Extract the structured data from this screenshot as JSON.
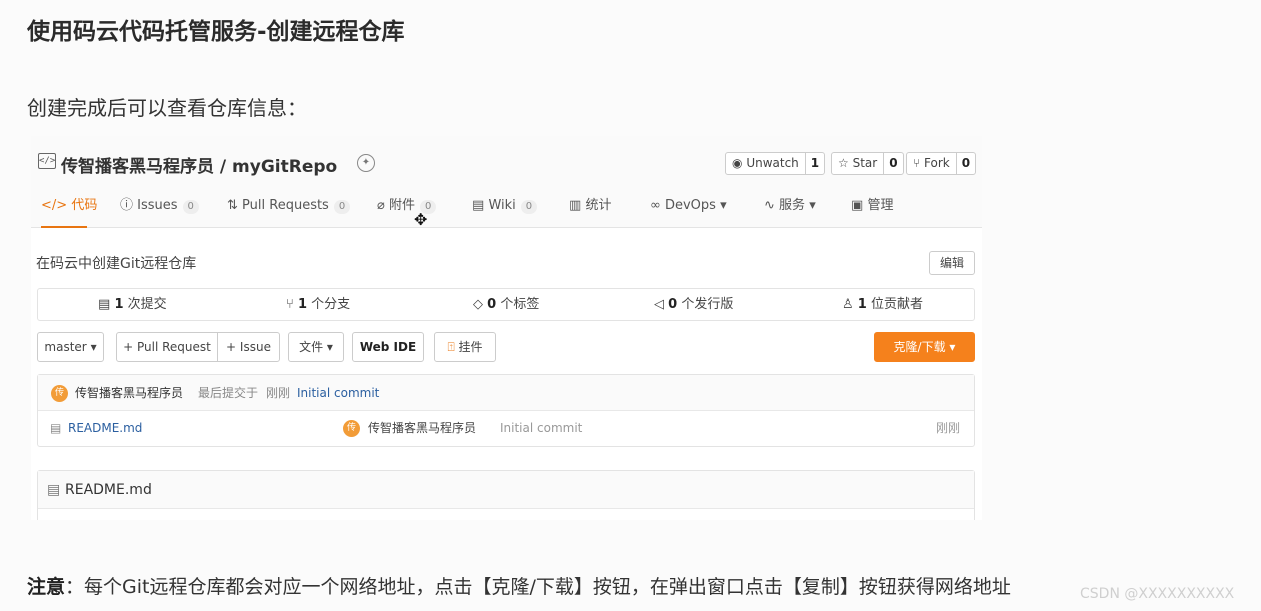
{
  "doc": {
    "heading": "使用码云代码托管服务-创建远程仓库",
    "intro": "创建完成后可以查看仓库信息：",
    "note_bold": "注意",
    "note_text": "：每个Git远程仓库都会对应一个网络地址，点击【克隆/下载】按钮，在弹出窗口点击【复制】按钮获得网络地址",
    "watermark": "CSDN @XXXXXXXXXX"
  },
  "repo": {
    "title": "传智播客黑马程序员 / myGitRepo",
    "description": "在码云中创建Git远程仓库",
    "edit_label": "编辑"
  },
  "actions": {
    "unwatch_label": "Unwatch",
    "unwatch_count": "1",
    "star_label": "Star",
    "star_count": "0",
    "fork_label": "Fork",
    "fork_count": "0"
  },
  "tabs": {
    "code": "代码",
    "issues": "Issues",
    "issues_count": "0",
    "pulls": "Pull Requests",
    "pulls_count": "0",
    "attach": "附件",
    "attach_count": "0",
    "wiki": "Wiki",
    "wiki_count": "0",
    "stats": "统计",
    "devops": "DevOps",
    "services": "服务",
    "manage": "管理"
  },
  "stats": {
    "commits_num": "1",
    "commits_label": "次提交",
    "branches_num": "1",
    "branches_label": "个分支",
    "tags_num": "0",
    "tags_label": "个标签",
    "releases_num": "0",
    "releases_label": "个发行版",
    "contributors_num": "1",
    "contributors_label": "位贡献者"
  },
  "toolbar": {
    "branch": "master",
    "pull_request": "+ Pull Request",
    "issue": "+ Issue",
    "files": "文件",
    "web_ide": "Web IDE",
    "widget": "挂件",
    "clone": "克隆/下载"
  },
  "commit": {
    "avatar_char": "传",
    "author": "传智播客黑马程序员",
    "last_commit_prefix": "最后提交于",
    "time": "刚刚",
    "message": "Initial commit"
  },
  "files": [
    {
      "name": "README.md",
      "author": "传智播客黑马程序员",
      "message": "Initial commit",
      "time": "刚刚"
    }
  ],
  "readme": {
    "title": "README.md"
  },
  "colors": {
    "accent": "#e87511",
    "clone_button": "#f5811c",
    "avatar": "#f29c38"
  }
}
